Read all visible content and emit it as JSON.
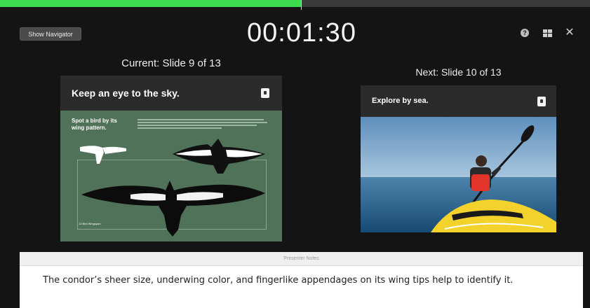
{
  "app": {
    "show_navigator_label": "Show Navigator",
    "timer": "00:01:30",
    "progress_fraction": 0.51,
    "icons": [
      "help-icon",
      "layout-icon",
      "close-icon"
    ],
    "accent_color": "#3ddc4f"
  },
  "current": {
    "label": "Current: Slide 9 of 13",
    "slide_title": "Keep an eye to the sky.",
    "subtitle": "Spot a bird by its wing pattern.",
    "caption": "13 Bird Wingspan"
  },
  "next": {
    "label": "Next: Slide 10 of 13",
    "slide_title": "Explore by sea."
  },
  "notes": {
    "header": "Presenter Notes",
    "text": "The condor’s sheer size, underwing color, and fingerlike appendages on its wing tips help to identify it."
  }
}
